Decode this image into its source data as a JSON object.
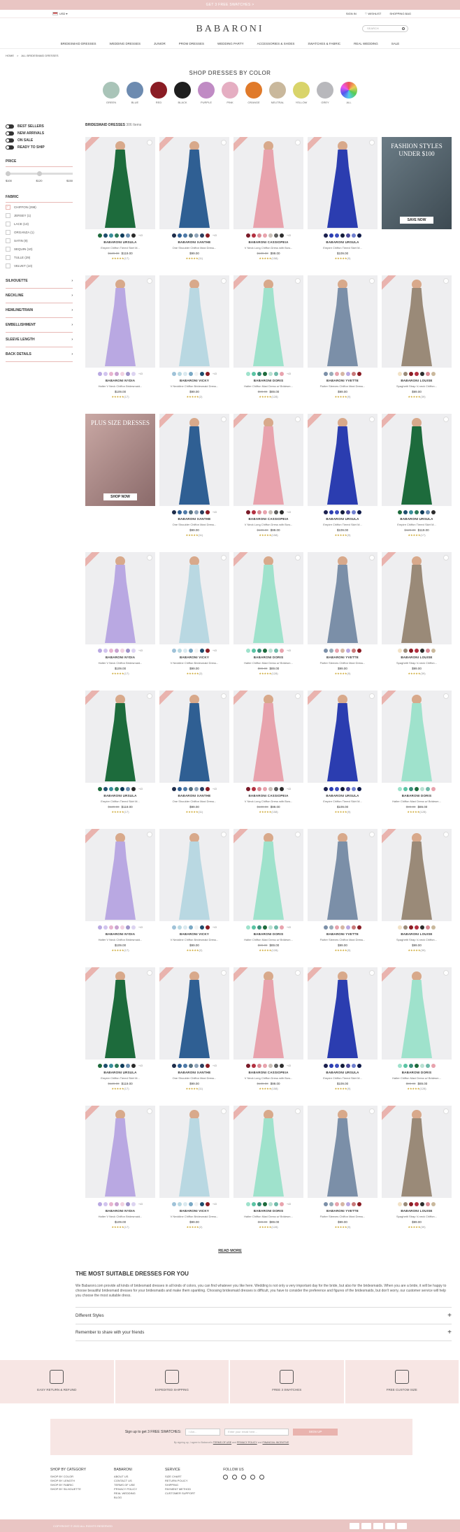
{
  "topbar": {
    "text": "GET 3 FREE SWATCHES  >"
  },
  "util": {
    "currency": "USD ▾",
    "signin": "SIGN IN",
    "wishlist": "♡ WISHLIST",
    "bag": "SHOPPING BAG"
  },
  "brand": {
    "logo": "BABARONI"
  },
  "search": {
    "placeholder": "SEARCH"
  },
  "nav": [
    "BRIDESMAID DRESSES",
    "WEDDING DRESSES",
    "JUNIOR",
    "PROM DRESSES",
    "WEDDING PARTY",
    "ACCESSORIES & SHOES",
    "SWATCHES & FABRIC",
    "REAL WEDDING",
    "SALE"
  ],
  "breadcrumb": {
    "home": "HOME",
    "sep": ">",
    "current": "ALL BRIDESMAID DRESSES"
  },
  "colors": {
    "title": "SHOP DRESSES BY COLOR",
    "items": [
      {
        "label": "GREEN",
        "hex": "#a9c4b8"
      },
      {
        "label": "BLUE",
        "hex": "#6d8bb0"
      },
      {
        "label": "RED",
        "hex": "#8a1c24"
      },
      {
        "label": "BLACK",
        "hex": "#1e1e1e"
      },
      {
        "label": "PURPLE",
        "hex": "#c08bc4"
      },
      {
        "label": "PINK",
        "hex": "#e5aec2"
      },
      {
        "label": "ORANGE",
        "hex": "#e07a2a"
      },
      {
        "label": "NEUTRAL",
        "hex": "#c9b89c"
      },
      {
        "label": "YELLOW",
        "hex": "#d9d46a"
      },
      {
        "label": "GREY",
        "hex": "#b8b8bc"
      },
      {
        "label": "ALL",
        "hex": "#c98bd6"
      }
    ]
  },
  "filters": {
    "toggles": [
      "BEST SELLERS",
      "NEW ARRIVALS",
      "ON SALE",
      "READY TO SHIP"
    ],
    "price_title": "PRICE",
    "price_min": "$100",
    "price_mid": "$120",
    "price_max": "$150",
    "fabric_title": "FABRIC",
    "fabrics": [
      "CHIFFON (298)",
      "JERSEY (1)",
      "LACE (13)",
      "ORGANZA (1)",
      "SATIN (9)",
      "SEQUIN (10)",
      "TULLE (29)",
      "VELVET (10)"
    ],
    "sections": [
      "SILHOUETTE",
      "NECKLINE",
      "HEMLINE/TRAIN",
      "EMBELLISHMENT",
      "SLEEVE LENGTH",
      "BACK DETAILS"
    ]
  },
  "grid": {
    "title": "BRIDESMAID DRESSES",
    "count": "306 Items"
  },
  "promos": {
    "fashion": {
      "title": "FASHION STYLES UNDER $100",
      "button": "SAVE NOW"
    },
    "plus": {
      "title": "PLUS SIZE DRESSES",
      "button": "SHOP NOW"
    }
  },
  "products": {
    "ursula": {
      "name": "BABARONI URSULA",
      "desc": "Empire Chiffon Tiered Skirt M...",
      "old": "$129.00",
      "price": "$119.00",
      "reviews": "(17)",
      "color": "#1d6b3c",
      "dots": [
        "#1d6b3c",
        "#1e4e6e",
        "#3a8f9a",
        "#2d7a5a",
        "#0e3b5a",
        "#6a8fb0",
        "#2b2b2b"
      ],
      "more": "+43"
    },
    "xanthe": {
      "name": "BABARONI XANTHE",
      "desc": "One Shoulder Chiffon Maxi Dress...",
      "old": "",
      "price": "$99.00",
      "reviews": "(11)",
      "color": "#2f5f93",
      "dots": [
        "#1d2c4a",
        "#2f5f93",
        "#4e7aa8",
        "#556f7f",
        "#8ea3b8",
        "#2a3f5f",
        "#8a1c24"
      ],
      "more": "+43"
    },
    "cassiopeia": {
      "name": "BABARONI CASSIOPEIA",
      "desc": "V Neck Long Chiffon Dress with Bow...",
      "old": "$109.00",
      "price": "$99.00",
      "reviews": "(158)",
      "color": "#e8a3ad",
      "dots": [
        "#7a1a28",
        "#b23040",
        "#d98b95",
        "#e8a3ad",
        "#c9c0b8",
        "#5e5e5e",
        "#2c2c2c"
      ],
      "more": "+43"
    },
    "ursula2": {
      "name": "BABARONI URSULA",
      "desc": "Empire Chiffon Tiered Skirt M...",
      "old": "",
      "price": "$109.00",
      "reviews": "(9)",
      "color": "#2b3db0",
      "dots": [
        "#1a1f4e",
        "#2b3db0",
        "#3d4ec0",
        "#121b3a",
        "#4a4a9a",
        "#6f7fd0",
        "#0e1a4a"
      ],
      "more": ""
    },
    "nydia": {
      "name": "BABARONI NYDIA",
      "desc": "Halter V Neck Chiffon Bridesmaid...",
      "old": "",
      "price": "$109.00",
      "reviews": "(17)",
      "color": "#b9a8e2",
      "dots": [
        "#b9a8e2",
        "#d1c4ee",
        "#e7b4cf",
        "#c8a2d0",
        "#f0d0e0",
        "#9f93c9",
        "#dcd3f0"
      ],
      "more": "+43"
    },
    "vicky": {
      "name": "BABARONI VICKY",
      "desc": "V Neckline Chiffon Bridesmaid Dress...",
      "old": "",
      "price": "$99.00",
      "reviews": "(2)",
      "color": "#b9d8e2",
      "dots": [
        "#9fc2d8",
        "#b9d8e2",
        "#dae9ef",
        "#7aa8c4",
        "#f2f2f2",
        "#1e4e6e",
        "#8a1c24"
      ],
      "more": "+43"
    },
    "doris": {
      "name": "BABARONI DORIS",
      "desc": "Halter Chiffon Maxi Dress w/ Bridesm...",
      "old": "$99.00",
      "price": "$89.00",
      "reviews": "(128)",
      "color": "#9fe2cc",
      "dots": [
        "#9fe2cc",
        "#5ac4a4",
        "#3a8f7a",
        "#1d6b3c",
        "#b8e0d2",
        "#6fb9a8",
        "#e8a3ad"
      ],
      "more": "+43"
    },
    "yvette": {
      "name": "BABARONI YVETTE",
      "desc": "Flutter Sleeves Chiffon Maxi Dress...",
      "old": "",
      "price": "$99.00",
      "reviews": "(9)",
      "color": "#7b8fa8",
      "dots": [
        "#7b8fa8",
        "#9aacb8",
        "#e8a3ad",
        "#d4b5a3",
        "#b9a8e2",
        "#c97a7a",
        "#8a1c24"
      ],
      "more": ""
    },
    "louise": {
      "name": "BABARONI LOUISE",
      "desc": "Spaghetti Strap V-neck Chiffon...",
      "old": "",
      "price": "$99.00",
      "reviews": "(39)",
      "color": "#9a8a78",
      "dots": [
        "#f2e2c6",
        "#9a8a78",
        "#8a1c24",
        "#b23040",
        "#2c2c2c",
        "#d98b95",
        "#c9b89c"
      ],
      "more": ""
    },
    "ursula3": {
      "name": "BABARONI URSULA",
      "desc": "Empire Chiffon Tiered Skirt M...",
      "old": "$129.00",
      "price": "$119.00",
      "reviews": "(17)",
      "color": "#1d6b3c",
      "dots": [
        "#1d6b3c",
        "#1e4e6e",
        "#3a8f9a",
        "#2d7a5a",
        "#0e3b5a",
        "#6a8fb0",
        "#2b2b2b"
      ],
      "more": ""
    },
    "doris2": {
      "name": "BABARONI DORIS",
      "desc": "Halter Chiffon Maxi Dress w/ Bridesm...",
      "old": "$99.00",
      "price": "$89.00",
      "reviews": "(128)",
      "color": "#9fe2cc",
      "dots": [
        "#9fe2cc",
        "#5ac4a4",
        "#3a8f7a",
        "#1d6b3c",
        "#b8e0d2",
        "#6fb9a8",
        "#e8a3ad"
      ],
      "more": ""
    },
    "nydia2": {
      "name": "BABARONI NYDIA",
      "desc": "Halter V Neck Chiffon Bridesmaid...",
      "old": "",
      "price": "$109.00",
      "reviews": "(17)",
      "color": "#b9a8e2",
      "dots": [
        "#b9a8e2",
        "#d1c4ee",
        "#e7b4cf",
        "#c8a2d0",
        "#f0d0e0",
        "#9f93c9",
        "#dcd3f0"
      ],
      "more": "+43"
    },
    "louise2": {
      "name": "BABARONI LOUISE",
      "desc": "Spaghetti Strap V-neck Chiffon...",
      "old": "",
      "price": "$99.00",
      "reviews": "(39)",
      "color": "#9a8a78",
      "dots": [
        "#f2e2c6",
        "#9a8a78",
        "#8a1c24",
        "#b23040",
        "#2c2c2c",
        "#d98b95",
        "#c9b89c"
      ],
      "more": ""
    }
  },
  "stars": "★★★★★",
  "readmore": "READ MORE",
  "seo": {
    "title": "THE MOST SUITABLE DRESSES FOR YOU",
    "body": "We Babaroni.com provide all kinds of bridesmaid dresses in all kinds of colors, you can find whatever you like here. Wedding is not only a very important day for the bride, but also for the bridesmaids. When you are a bride, it will be happy to choose beautiful bridesmaid dresses for your bridesmaids and make them sparkling. Choosing bridesmaid dresses is difficult, you have to consider the preference and figures of the bridesmaids, but don't worry, our customer service will help you choose the most suitable dress.",
    "acc1": "Different Styles",
    "acc2": "Remember to share with your friends",
    "plus": "+"
  },
  "services": [
    "EASY RETURN & REFUND",
    "EXPEDITED SHIPPING",
    "FREE 3 SWATCHES",
    "FREE CUSTOM SIZE"
  ],
  "signup": {
    "label": "Sign up to get 3 FREE SWATCHES:",
    "select": "I Am...",
    "placeholder": "Enter your email here...",
    "button": "SIGN UP",
    "fine_pre": "By signing up, I agree to Babaroni's",
    "terms": "TERMS OF USE",
    "and": "and",
    "privacy": "PRIVACY POLICY",
    "and2": "and",
    "financial": "FINANCIAL INCENTIVE"
  },
  "footer": {
    "cat_title": "SHOP BY CATEGORY",
    "cat": [
      "SHOP BY COLOR",
      "SHOP BY LENGTH",
      "SHOP BY FABRIC",
      "SHOP BY SILHOUETTE"
    ],
    "brand_title": "BABARONI",
    "brand": [
      "ABOUT US",
      "CONTACT US",
      "TERMS OF USE",
      "PRIVACY POLICY",
      "REAL WEDDING",
      "BLOG"
    ],
    "service_title": "SERVICE",
    "service": [
      "SIZE CHART",
      "RETURN POLICY",
      "SHIPPING",
      "PAYMENT METHOD",
      "CUSTOMER SUPPORT"
    ],
    "follow_title": "FOLLOW US"
  },
  "bottom": {
    "copyright": "COPYRIGHT © 2022 ALL RIGHTS RESERVED"
  }
}
